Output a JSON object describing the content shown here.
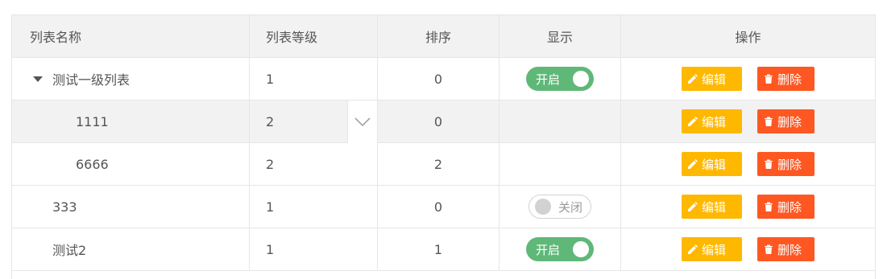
{
  "table": {
    "headers": {
      "name": "列表名称",
      "level": "列表等级",
      "sort": "排序",
      "show": "显示",
      "op": "操作"
    },
    "rows": [
      {
        "name": "测试一级列表",
        "level": "1",
        "sort": "0",
        "show": "开启",
        "show_state": "on",
        "expanded": true
      },
      {
        "name": "1111",
        "level": "2",
        "sort": "0",
        "show": "",
        "show_state": "none"
      },
      {
        "name": "6666",
        "level": "2",
        "sort": "2",
        "show": "",
        "show_state": "none"
      },
      {
        "name": "333",
        "level": "1",
        "sort": "0",
        "show": "关闭",
        "show_state": "off"
      },
      {
        "name": "测试2",
        "level": "1",
        "sort": "1",
        "show": "开启",
        "show_state": "on"
      }
    ],
    "edit_label": "编辑",
    "delete_label": "删除"
  },
  "colors": {
    "edit": "#ffb800",
    "delete": "#ff5722",
    "toggle_on": "#5fb878",
    "header_bg": "#f2f2f2"
  }
}
